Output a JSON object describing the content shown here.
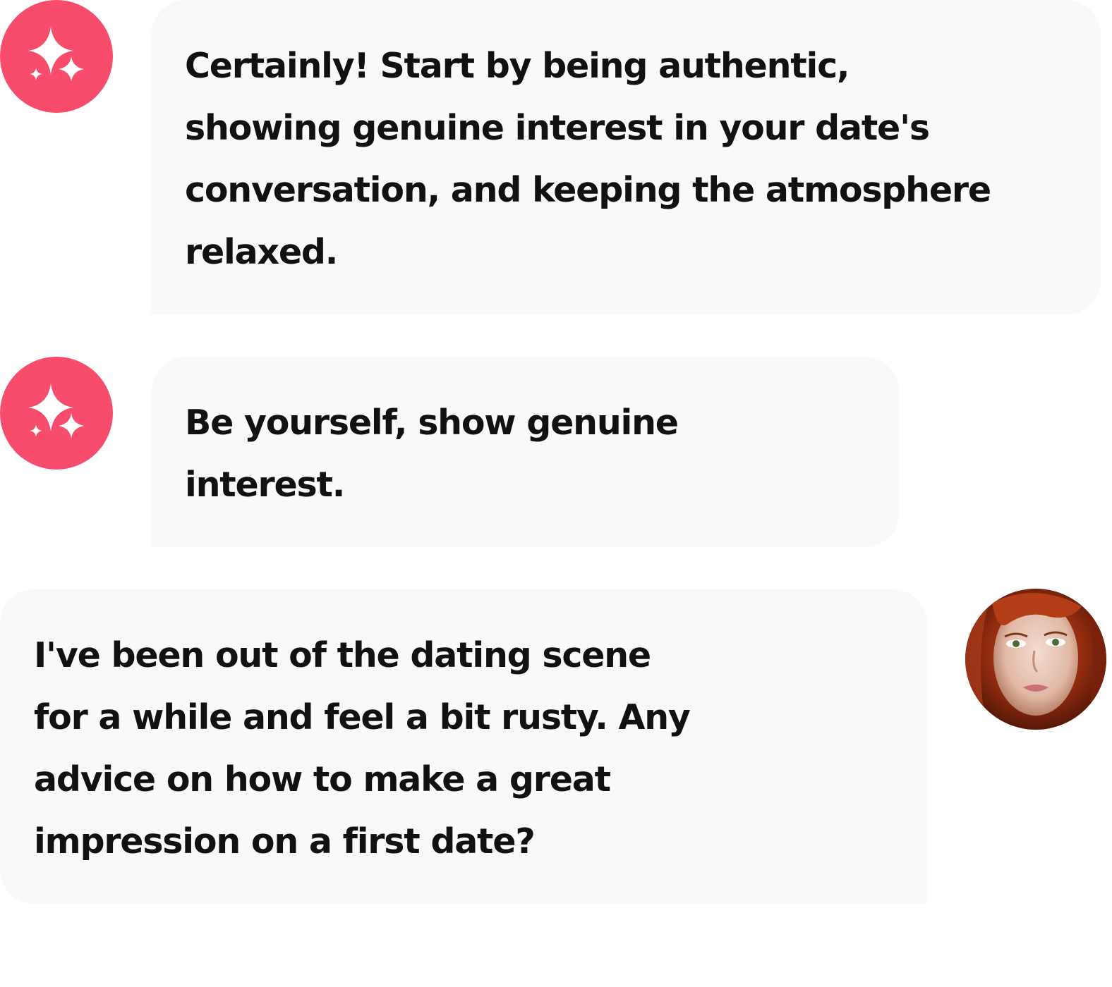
{
  "conversation": {
    "messages": [
      {
        "sender": "assistant",
        "avatar_icon": "sparkle-icon",
        "text": " Certainly! Start by being authentic,\nshowing genuine interest in your date's\nconversation, and keeping the atmosphere\nrelaxed."
      },
      {
        "sender": "assistant",
        "avatar_icon": "sparkle-icon",
        "text": "Be yourself, show genuine\ninterest."
      },
      {
        "sender": "user",
        "avatar_icon": "user-photo",
        "text": "I've been out of the dating scene\nfor a while and feel a bit rusty. Any\nadvice on how to make a great\nimpression on a first date?"
      }
    ]
  },
  "colors": {
    "accent": "#f74c6b",
    "bubble_background": "#f9f9f9",
    "text": "#111111"
  }
}
